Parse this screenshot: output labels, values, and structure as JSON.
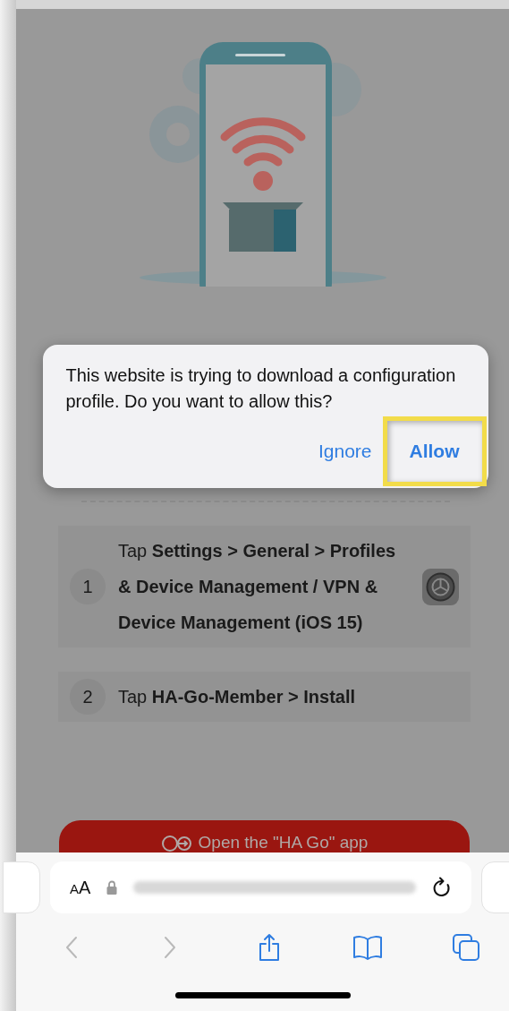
{
  "dialog": {
    "message": "This website is trying to download a configuration profile. Do you want to allow this?",
    "buttons": [
      {
        "label": "Ignore",
        "highlighted": false
      },
      {
        "label": "Allow",
        "highlighted": true
      }
    ]
  },
  "steps": [
    {
      "number": "1",
      "text": "Tap **Settings > General > Profiles & Device Management / VPN & Device Management (iOS 15)**",
      "settings_icon": true
    },
    {
      "number": "2",
      "text": "Tap **HA-Go-Member > Install**",
      "settings_icon": false
    }
  ],
  "open_app_button": {
    "label": "Open the \"HA Go\" app"
  },
  "address_bar": {
    "text_size_button": "AA"
  },
  "toolbar": [
    {
      "kind": "back",
      "disabled": true
    },
    {
      "kind": "forward",
      "disabled": true
    },
    {
      "kind": "share",
      "disabled": false
    },
    {
      "kind": "bookmarks",
      "disabled": false
    },
    {
      "kind": "tabs",
      "disabled": false
    }
  ]
}
